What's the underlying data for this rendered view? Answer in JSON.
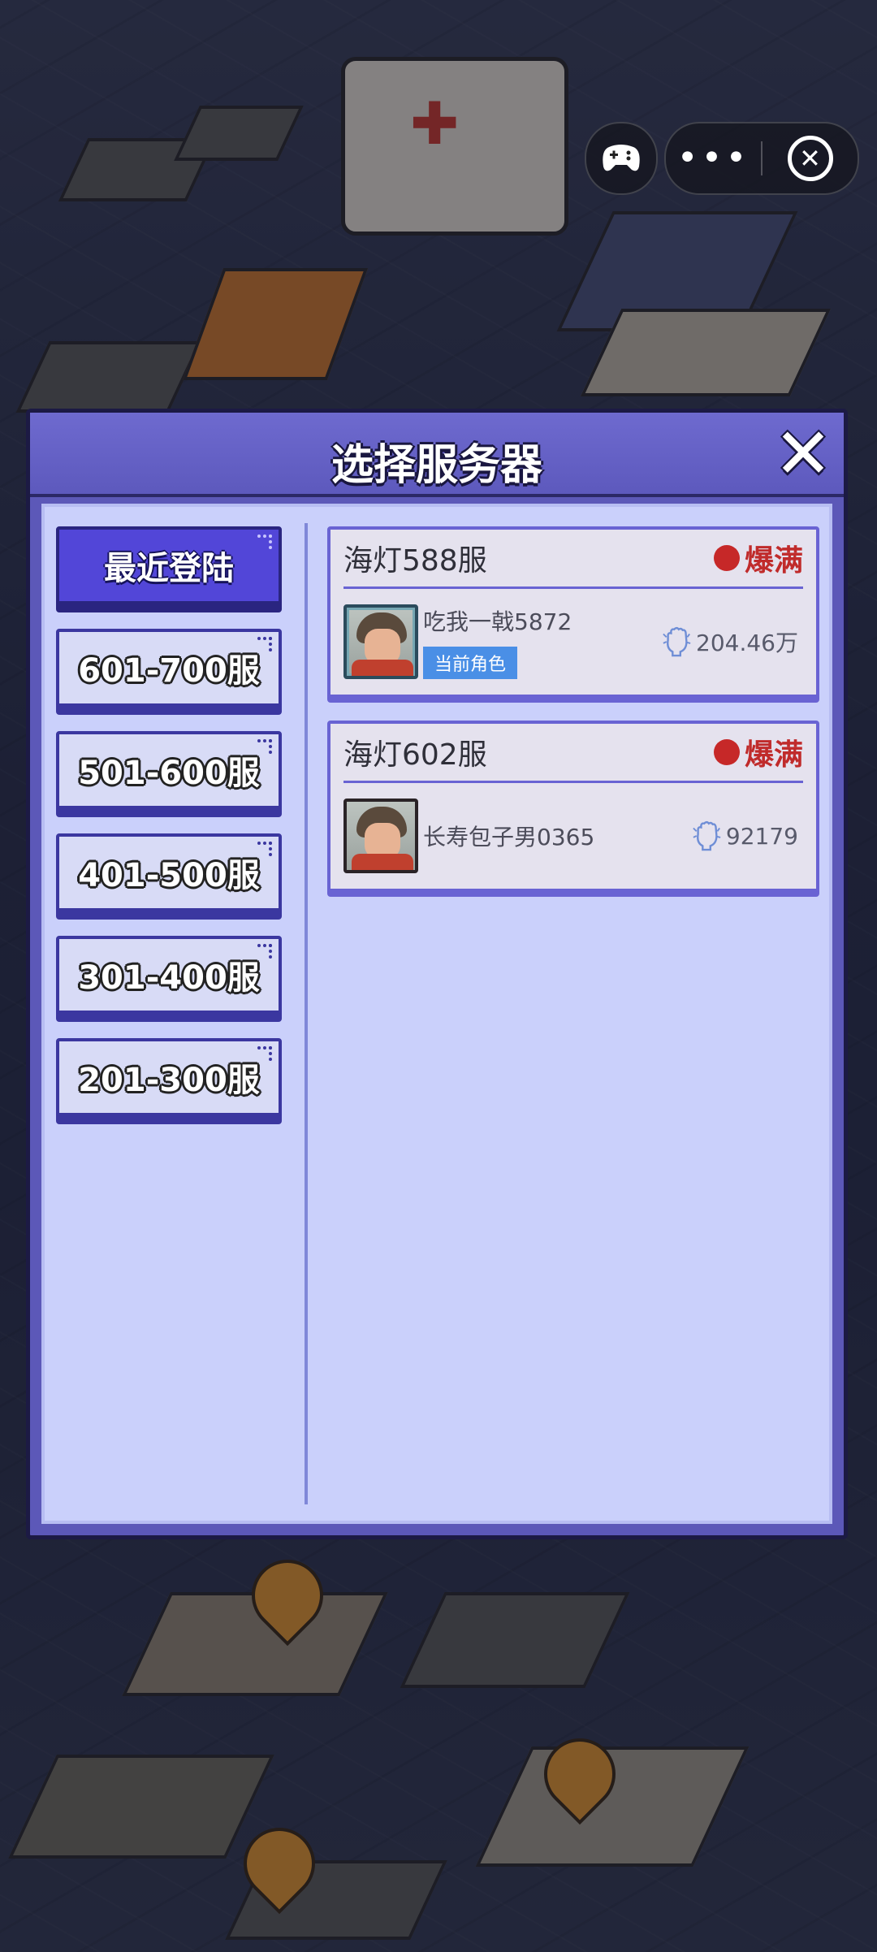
{
  "dialog": {
    "title": "选择服务器"
  },
  "tabs": [
    {
      "label": "最近登陆",
      "active": true
    },
    {
      "label": "601-700服",
      "active": false
    },
    {
      "label": "501-600服",
      "active": false
    },
    {
      "label": "401-500服",
      "active": false
    },
    {
      "label": "301-400服",
      "active": false
    },
    {
      "label": "201-300服",
      "active": false
    }
  ],
  "servers": [
    {
      "name": "海灯588服",
      "status": "爆满",
      "role_name": "吃我一戟5872",
      "badge": "当前角色",
      "power": "204.46万"
    },
    {
      "name": "海灯602服",
      "status": "爆满",
      "role_name": "长寿包子男0365",
      "power": "92179"
    }
  ],
  "icons": {
    "game": "gamepad-icon",
    "more": "more-dots-icon",
    "exit": "close-circle-icon",
    "close": "close-x-icon",
    "power": "fist-power-icon",
    "status": "red-dot-icon"
  },
  "colors": {
    "accent": "#5246d8",
    "status_full": "#c02b2b",
    "badge": "#4a8fe6"
  }
}
